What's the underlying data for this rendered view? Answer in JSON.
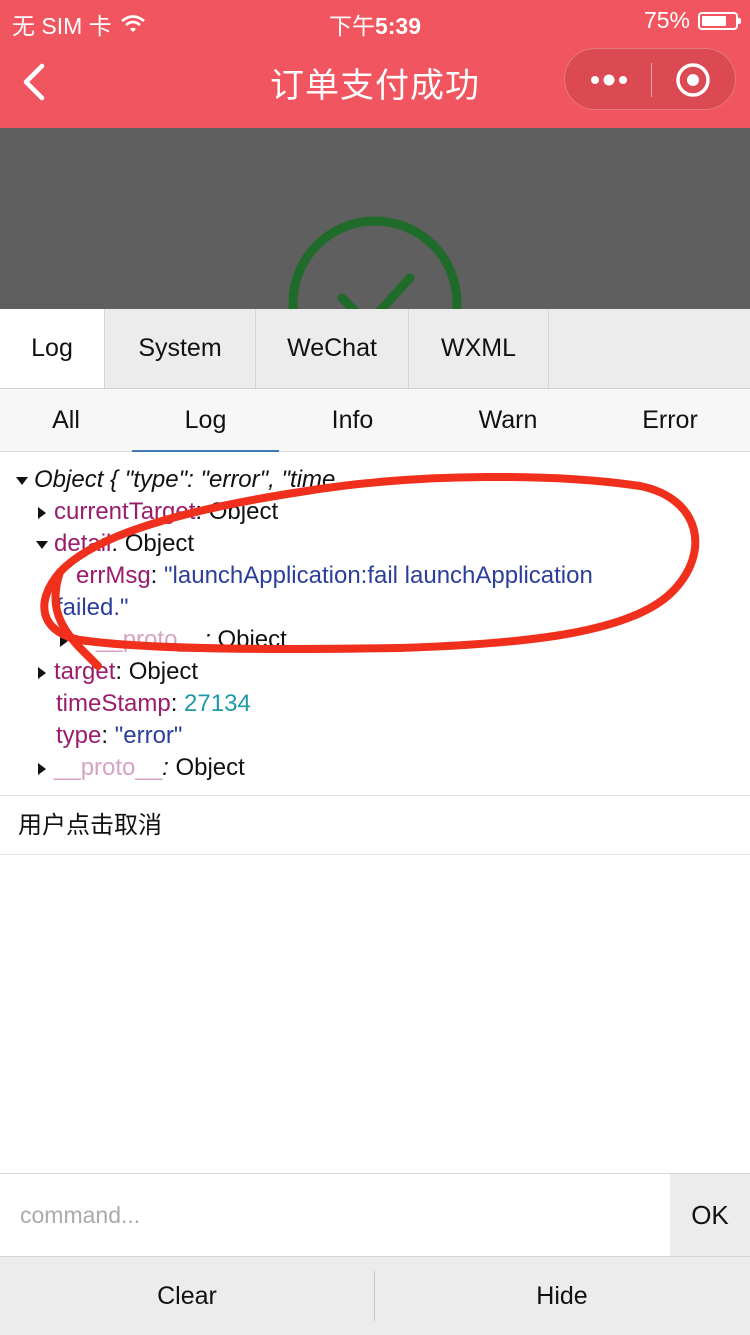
{
  "status_bar": {
    "carrier": "无 SIM 卡",
    "time_prefix": "下午",
    "time": "5:39",
    "battery_percent": "75%",
    "battery_level": 0.75
  },
  "nav": {
    "title": "订单支付成功"
  },
  "colors": {
    "nav_bg": "#f1555f",
    "preview_bg": "#5f5f5f",
    "check_green": "#1f6b2a",
    "annotation_red": "#f0301c"
  },
  "tabs": [
    {
      "label": "Log",
      "active": true
    },
    {
      "label": "System",
      "active": false
    },
    {
      "label": "WeChat",
      "active": false
    },
    {
      "label": "WXML",
      "active": false
    }
  ],
  "filters": [
    {
      "label": "All",
      "active": false
    },
    {
      "label": "Log",
      "active": true
    },
    {
      "label": "Info",
      "active": false
    },
    {
      "label": "Warn",
      "active": false
    },
    {
      "label": "Error",
      "active": false
    }
  ],
  "log": {
    "object_header": "Object { \"type\": \"error\", \"time…",
    "current_target_key": "currentTarget",
    "current_target_value": "Object",
    "detail_key": "detail",
    "detail_value": "Object",
    "errmsg_key": "errMsg",
    "errmsg_value_line1": "\"launchApplication:fail launchApplication",
    "errmsg_value_line2": "failed.\"",
    "inner_proto_key": "__proto__",
    "inner_proto_value": "Object",
    "target_key": "target",
    "target_value": "Object",
    "timestamp_key": "timeStamp",
    "timestamp_value": "27134",
    "type_key": "type",
    "type_value": "\"error\"",
    "proto_key": "__proto__",
    "proto_value": "Object",
    "message": "用户点击取消"
  },
  "command": {
    "placeholder": "command...",
    "ok_label": "OK"
  },
  "bottom": {
    "clear_label": "Clear",
    "hide_label": "Hide"
  }
}
